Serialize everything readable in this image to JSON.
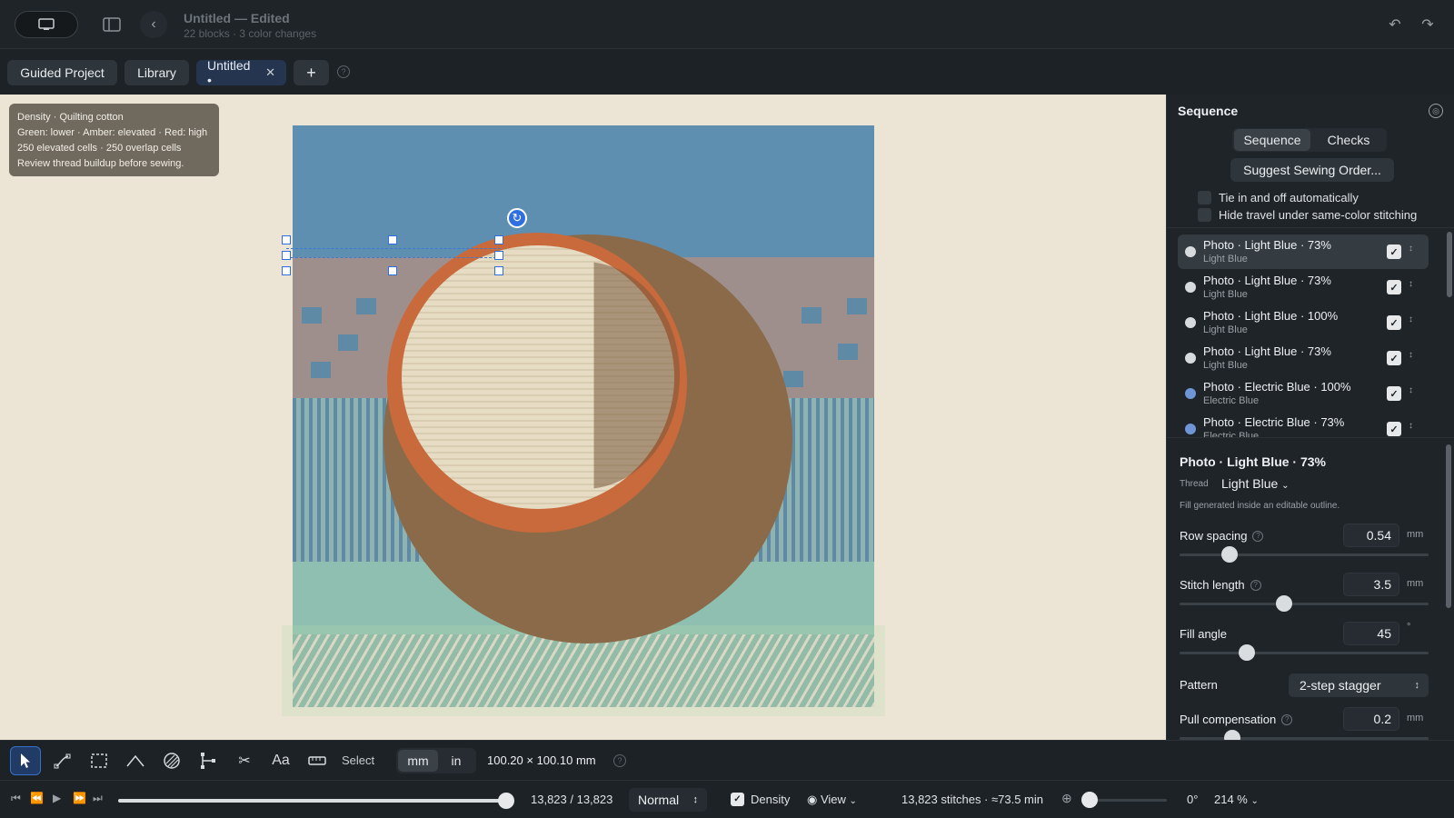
{
  "window": {
    "title": "Untitled — Edited",
    "subtitle": "22 blocks · 3 color changes"
  },
  "tabs": [
    {
      "label": "Guided Project"
    },
    {
      "label": "Library"
    },
    {
      "label": "Untitled •",
      "active": true
    }
  ],
  "density_card": {
    "line1": "Density · Quilting cotton",
    "line2": "Green: lower · Amber: elevated · Red: high",
    "line3": "250 elevated cells · 250 overlap cells",
    "line4": "Review thread buildup before sewing."
  },
  "panel": {
    "title": "Sequence",
    "segments": {
      "sequence": "Sequence",
      "checks": "Checks"
    },
    "suggest_button": "Suggest Sewing Order...",
    "options": [
      {
        "label": "Tie in and off automatically",
        "checked": false
      },
      {
        "label": "Hide travel under same-color stitching",
        "checked": false
      }
    ],
    "sequence_items": [
      {
        "name": "Photo · Light Blue · 73%",
        "thread": "Light Blue",
        "color": "#d8dbde",
        "selected": true
      },
      {
        "name": "Photo · Light Blue · 73%",
        "thread": "Light Blue",
        "color": "#d8dbde"
      },
      {
        "name": "Photo · Light Blue · 100%",
        "thread": "Light Blue",
        "color": "#d8dbde"
      },
      {
        "name": "Photo · Light Blue · 73%",
        "thread": "Light Blue",
        "color": "#d8dbde"
      },
      {
        "name": "Photo · Electric Blue · 100%",
        "thread": "Electric Blue",
        "color": "#6f95d6"
      },
      {
        "name": "Photo · Electric Blue · 73%",
        "thread": "Electric Blue",
        "color": "#6f95d6"
      }
    ],
    "properties": {
      "title": "Photo · Light Blue · 73%",
      "thread_label": "Thread",
      "thread_value": "Light Blue",
      "fill_note": "Fill generated inside an editable outline.",
      "row_spacing": {
        "label": "Row spacing",
        "value": "0.54",
        "unit": "mm",
        "fraction": 0.2
      },
      "stitch_length": {
        "label": "Stitch length",
        "value": "3.5",
        "unit": "mm",
        "fraction": 0.42
      },
      "fill_angle": {
        "label": "Fill angle",
        "value": "45",
        "unit": "°",
        "fraction": 0.27
      },
      "pattern": {
        "label": "Pattern",
        "value": "2-step stagger"
      },
      "pull_compensation": {
        "label": "Pull compensation",
        "value": "0.2",
        "unit": "mm",
        "fraction": 0.21
      }
    }
  },
  "toolbar": {
    "mode_label": "Select",
    "unit_mm": "mm",
    "unit_in": "in",
    "dimensions": "100.20 × 100.10 mm"
  },
  "playback": {
    "position": "13,823 / 13,823",
    "speed": "Normal",
    "density_label": "Density",
    "view_label": "View",
    "stats": "13,823 stitches · ≈73.5 min",
    "angle": "0°",
    "zoom": "214 %",
    "progress": 1.0
  },
  "colors": {
    "accent": "#2f6fe0",
    "canvas_bg": "#ece4d4"
  }
}
